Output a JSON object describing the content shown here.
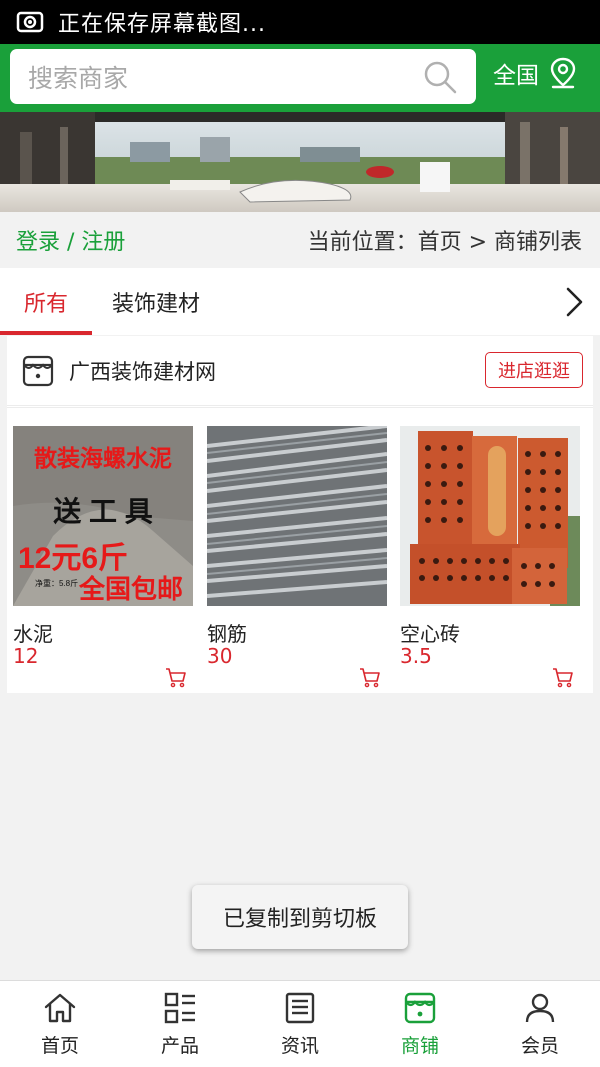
{
  "status_bar": {
    "text": "正在保存屏幕截图..."
  },
  "search": {
    "placeholder": "搜索商家"
  },
  "region": {
    "label": "全国"
  },
  "breadcrumb": {
    "login_register": "登录 / 注册",
    "location": "当前位置：首页 > 商铺列表"
  },
  "tabs": [
    {
      "label": "所有",
      "active": true
    },
    {
      "label": "装饰建材",
      "active": false
    }
  ],
  "shop": {
    "name": "广西装饰建材网",
    "visit_label": "进店逛逛",
    "products": [
      {
        "name": "水泥",
        "price": "12",
        "image_text": {
          "line1": "散装海螺水泥",
          "line2": "送 工 具",
          "line3": "12元6斤",
          "line4": "全国包邮",
          "small": "净重：5.8斤"
        }
      },
      {
        "name": "钢筋",
        "price": "30"
      },
      {
        "name": "空心砖",
        "price": "3.5"
      }
    ]
  },
  "toast": {
    "text": "已复制到剪切板"
  },
  "bottom_nav": [
    {
      "label": "首页",
      "icon": "home-icon",
      "active": false
    },
    {
      "label": "产品",
      "icon": "product-list-icon",
      "active": false
    },
    {
      "label": "资讯",
      "icon": "news-icon",
      "active": false
    },
    {
      "label": "商铺",
      "icon": "shop-icon",
      "active": true
    },
    {
      "label": "会员",
      "icon": "member-icon",
      "active": false
    }
  ],
  "colors": {
    "brand_green": "#1aa03a",
    "accent_red": "#d9272e"
  }
}
